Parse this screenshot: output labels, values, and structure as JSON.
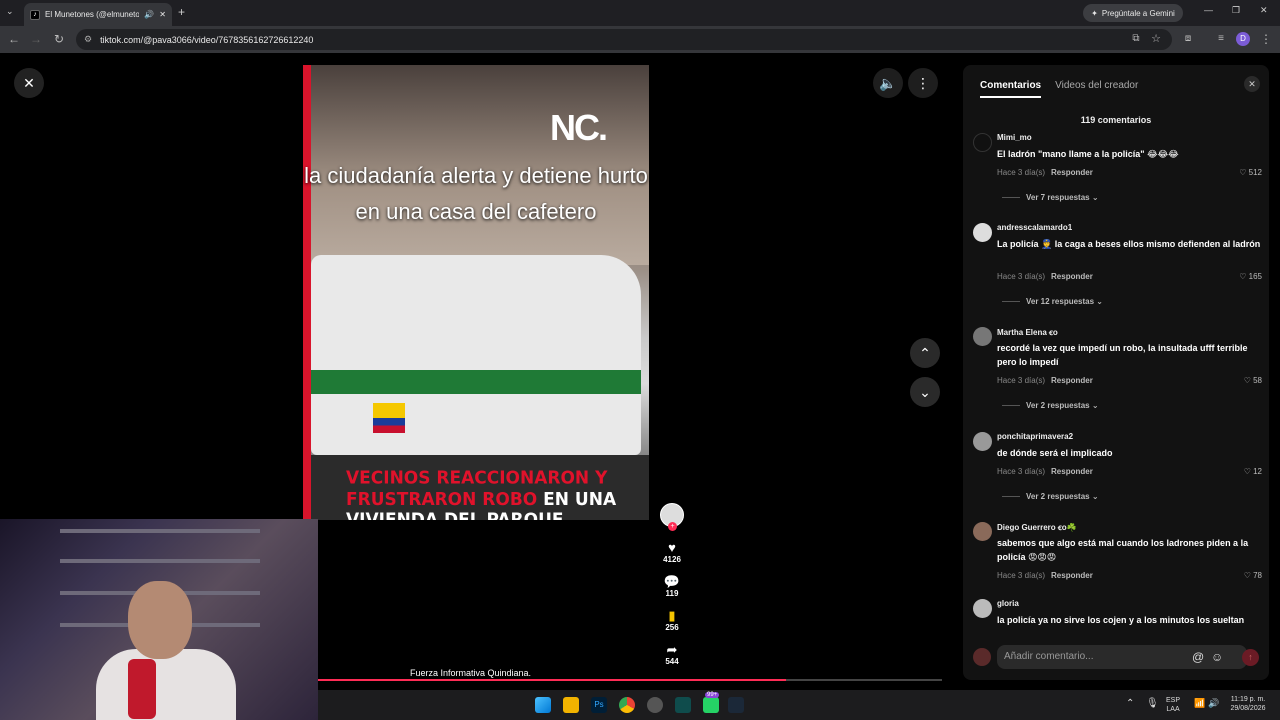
{
  "browser": {
    "tab_title": "El Munetones (@elmunetones)",
    "tab_favicon": "tiktok-icon",
    "url": "tiktok.com/@pava3066/video/7678356162726612240",
    "gemini_label": "Pregúntale a Gemini",
    "profile_initial": "D"
  },
  "video": {
    "logo": "NC.",
    "headline": "la ciudadanía alerta y detiene hurto en una casa del cafetero",
    "bottom_red": "VECINOS REACCIONARON Y FRUSTRARON ROBO",
    "bottom_white": " EN UNA VIVIENDA DEL PARQUE CAFETERO EN ARMENIA",
    "caption": "Fuerza Informativa Quindiana.",
    "progress_fraction": 0.75
  },
  "actions": {
    "likes": "4126",
    "comments": "119",
    "saves": "256",
    "shares": "544"
  },
  "panel": {
    "tab_comments": "Comentarios",
    "tab_creator": "Videos del creador",
    "count": "119 comentarios",
    "input_placeholder": "Añadir comentario...",
    "comments": [
      {
        "user": "Mimi_mo",
        "text": "El ladrón \"mano llame a la policía\" 😂😂😂",
        "time": "Hace 3 día(s)",
        "reply": "Responder",
        "likes": "512",
        "replies": "Ver 7 respuestas"
      },
      {
        "user": "andresscalamardo1",
        "text": "La policía 👮 la caga a beses ellos mismo defienden al ladrón",
        "time": "Hace 3 día(s)",
        "reply": "Responder",
        "likes": "165",
        "replies": "Ver 12 respuestas"
      },
      {
        "user": "Martha Elena ꞓo",
        "text": "recordé la vez que impedí un robo, la insultada ufff terrible pero lo impedí",
        "time": "Hace 3 día(s)",
        "reply": "Responder",
        "likes": "58",
        "replies": "Ver 2 respuestas"
      },
      {
        "user": "ponchitaprimavera2",
        "text": "de dónde será el implicado",
        "time": "Hace 3 día(s)",
        "reply": "Responder",
        "likes": "12",
        "replies": "Ver 2 respuestas"
      },
      {
        "user": "Diego Guerrero ꞓo☘️",
        "text": "sabemos que algo está mal cuando los ladrones piden a la policía 😡😡😡",
        "time": "Hace 3 día(s)",
        "reply": "Responder",
        "likes": "78",
        "replies": ""
      },
      {
        "user": "gloria",
        "text": "la policía ya no sirve los cojen y a los minutos los sueltan",
        "time": "",
        "reply": "",
        "likes": "",
        "replies": ""
      }
    ]
  },
  "taskbar": {
    "lang_top": "ESP",
    "lang_bottom": "LAA",
    "time": "11:19 p. m.",
    "date": "29/08/2026",
    "badge": "99+"
  },
  "colors": {
    "accent": "#fe2c55",
    "panel_bg": "#121212",
    "police_green": "#1f7a36"
  }
}
